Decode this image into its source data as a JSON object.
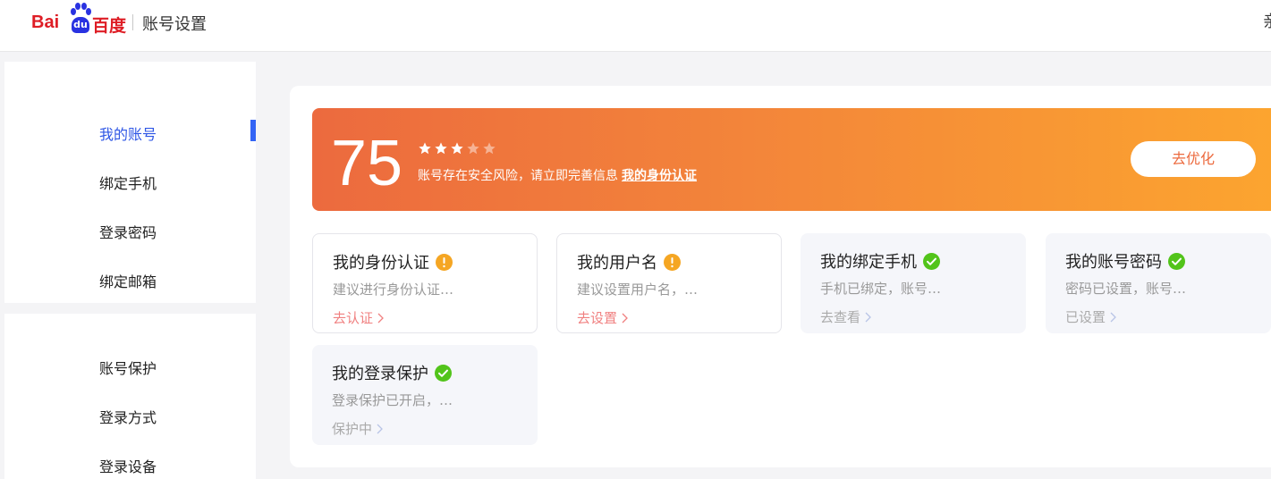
{
  "header": {
    "logo_prefix": "Bai",
    "logo_mid": "du",
    "logo_suffix": "百度",
    "title": "账号设置",
    "right_char": "亲"
  },
  "sidebar": {
    "group1": [
      {
        "label": "我的账号",
        "active": true
      },
      {
        "label": "绑定手机"
      },
      {
        "label": "登录密码"
      },
      {
        "label": "绑定邮箱"
      }
    ],
    "group2": [
      {
        "label": "账号保护"
      },
      {
        "label": "登录方式"
      },
      {
        "label": "登录设备"
      }
    ]
  },
  "banner": {
    "score": "75",
    "stars_filled": 3,
    "stars_total": 5,
    "message": "账号存在安全风险，请立即完善信息",
    "link_label": "我的身份认证",
    "button_label": "去优化"
  },
  "cards": [
    {
      "title": "我的身份认证",
      "status": "warn",
      "desc": "建议进行身份认证…",
      "action": "去认证"
    },
    {
      "title": "我的用户名",
      "status": "warn",
      "desc": "建议设置用户名，…",
      "action": "去设置"
    },
    {
      "title": "我的绑定手机",
      "status": "ok",
      "desc": "手机已绑定，账号…",
      "action": "去查看"
    },
    {
      "title": "我的账号密码",
      "status": "ok",
      "desc": "密码已设置，账号…",
      "action": "已设置"
    },
    {
      "title": "我的登录保护",
      "status": "ok",
      "desc": "登录保护已开启，…",
      "action": "保护中"
    }
  ],
  "colors": {
    "accent_blue": "#2e56e5",
    "warn": "#f5a623",
    "ok": "#52c41a",
    "banner_start": "#ec6a3e",
    "banner_end": "#fca52f"
  }
}
